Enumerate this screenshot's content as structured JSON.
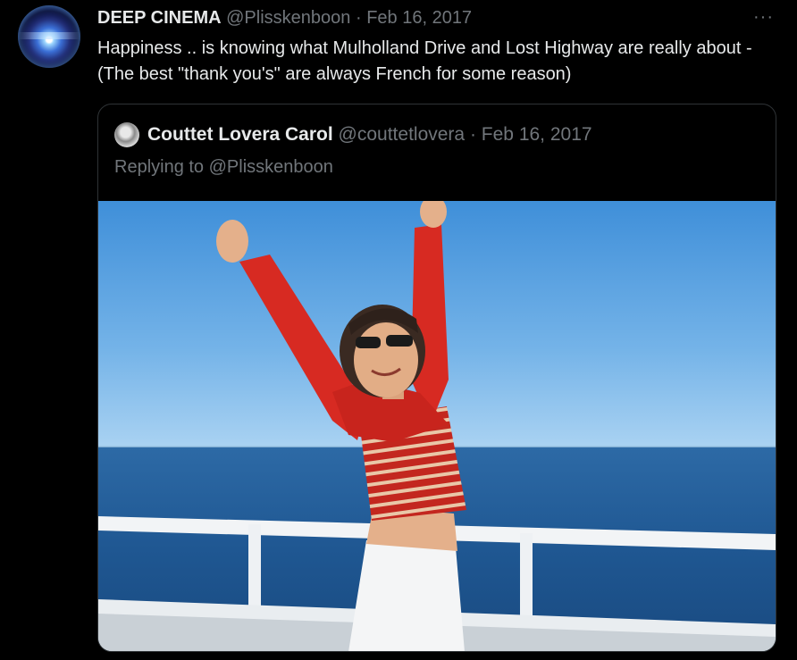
{
  "tweet": {
    "author_name": "DEEP CINEMA",
    "author_handle": "@Plisskenboon",
    "separator": "·",
    "date": "Feb 16, 2017",
    "more_label": "···",
    "text": "Happiness .. is knowing what Mulholland Drive and Lost Highway are really about - (The best \"thank you's\" are always French for some reason)"
  },
  "quoted": {
    "author_name": "Couttet Lovera Carol",
    "author_handle": "@couttetlovera",
    "separator": "·",
    "date": "Feb 16, 2017",
    "replying_to": "Replying to @Plisskenboon"
  },
  "icons": {
    "more": "more-options-icon"
  },
  "colors": {
    "background": "#000000",
    "text_primary": "#e7e9ea",
    "text_secondary": "#71767b",
    "border": "#2f3336"
  }
}
